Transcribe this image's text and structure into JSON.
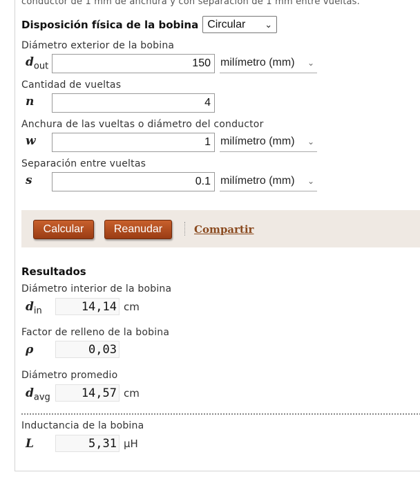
{
  "intro_text": "conductor de 1 mm de anchura y con separación de 1 mm entre vueltas.",
  "layout": {
    "label": "Disposición física de la bobina",
    "selected": "Circular"
  },
  "inputs": [
    {
      "label": "Diámetro exterior de la bobina",
      "symbol": "d",
      "subscript": "out",
      "value": "150",
      "unit": "milímetro (mm)"
    },
    {
      "label": "Cantidad de vueltas",
      "symbol": "n",
      "subscript": "",
      "value": "4",
      "unit": ""
    },
    {
      "label": "Anchura de las vueltas o diámetro del conductor",
      "symbol": "w",
      "subscript": "",
      "value": "1",
      "unit": "milímetro (mm)"
    },
    {
      "label": "Separación entre vueltas",
      "symbol": "s",
      "subscript": "",
      "value": "0.1",
      "unit": "milímetro (mm)"
    }
  ],
  "actions": {
    "calculate": "Calcular",
    "reset": "Reanudar",
    "share": "Compartir"
  },
  "results": {
    "title": "Resultados",
    "items": [
      {
        "label": "Diámetro interior de la bobina",
        "symbol": "d",
        "subscript": "in",
        "value": "14,14",
        "unit": "cm"
      },
      {
        "label": "Factor de relleno de la bobina",
        "symbol": "ρ",
        "subscript": "",
        "value": "0,03",
        "unit": ""
      },
      {
        "label": "Diámetro promedio",
        "symbol": "d",
        "subscript": "avg",
        "value": "14,57",
        "unit": "cm"
      },
      {
        "label": "Inductancia de la bobina",
        "symbol": "L",
        "subscript": "",
        "value": "5,31",
        "unit": "μH"
      }
    ]
  },
  "icons": {
    "select_chevron": "chevron-down-icon",
    "unit_chevron": "chevron-down-icon"
  },
  "colors": {
    "button_bg": "#b04a1e",
    "action_bar_bg": "#efe9e3",
    "link": "#8a4a1f"
  }
}
